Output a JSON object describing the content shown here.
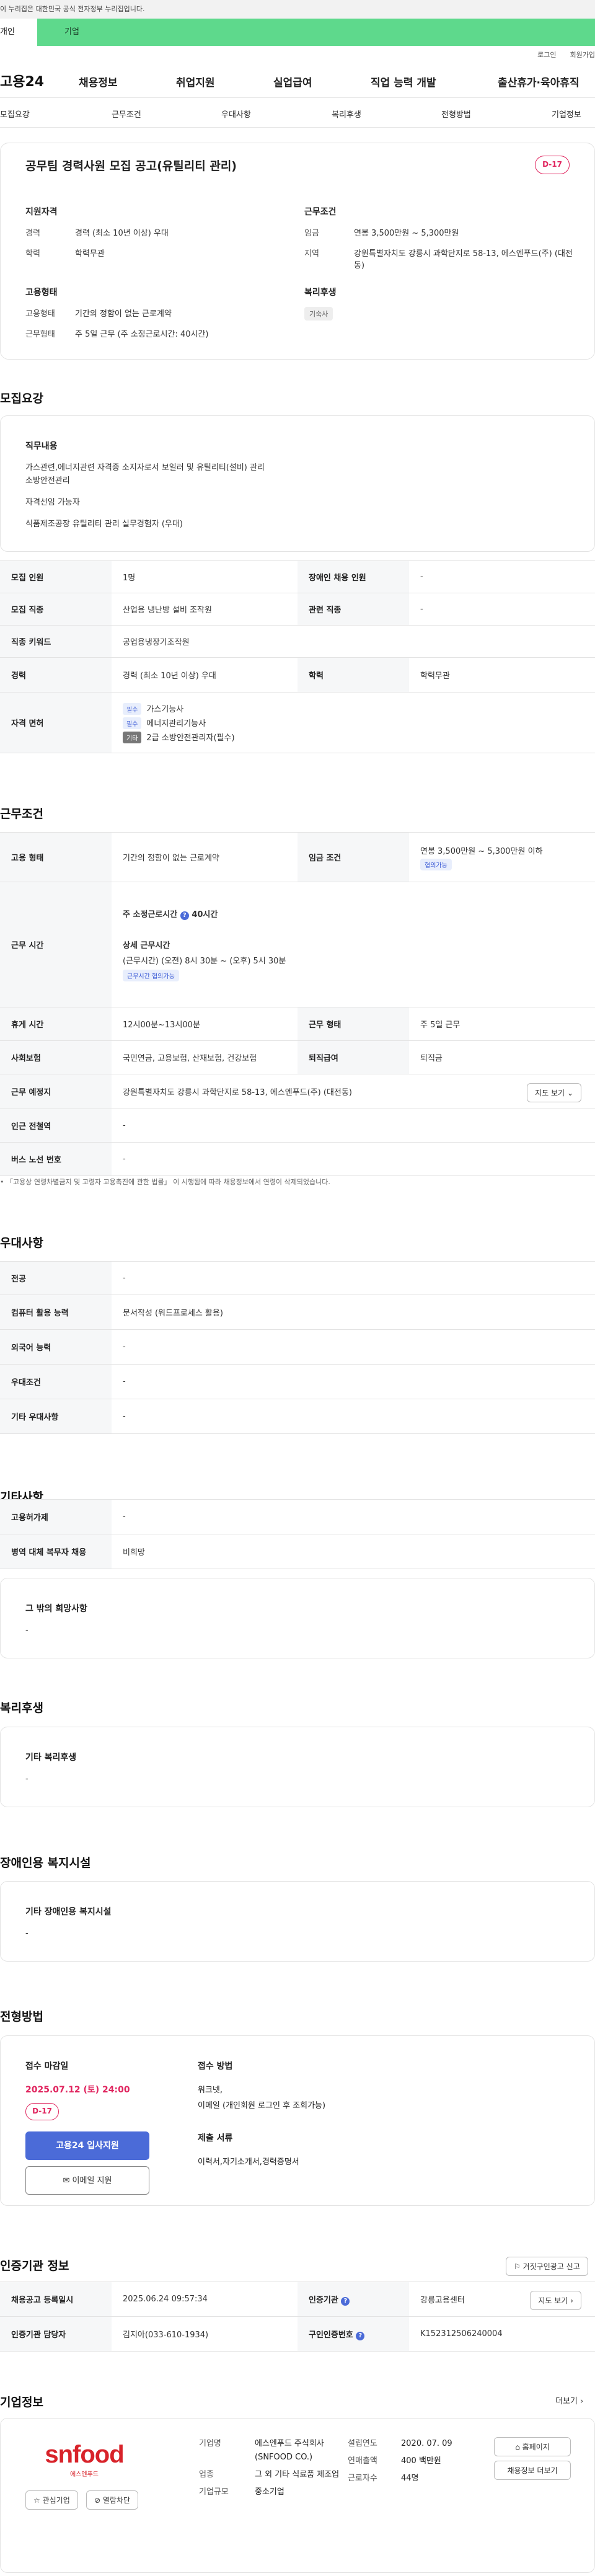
{
  "gov_banner": "이 누리집은 대한민국 공식 전자정부 누리집입니다.",
  "top_tabs": {
    "personal": "개인",
    "company": "기업"
  },
  "util": {
    "login": "로그인",
    "join": "회원가입"
  },
  "logo": "고용24",
  "gnb": [
    "채용정보",
    "취업지원",
    "실업급여",
    "직업 능력 개발",
    "출산휴가·육아휴직"
  ],
  "subnav": [
    "모집요강",
    "근무조건",
    "우대사항",
    "복리후생",
    "전형방법",
    "기업정보"
  ],
  "hero": {
    "title": "공무팀 경력사원 모집 공고(유틸리티 관리)",
    "dday": "D-17",
    "qual_title": "지원자격",
    "qual": [
      {
        "k": "경력",
        "v": "경력 (최소 10년 이상) 우대"
      },
      {
        "k": "학력",
        "v": "학력무관"
      }
    ],
    "cond_title": "근무조건",
    "cond": [
      {
        "k": "임금",
        "v": "연봉 3,500만원 ~ 5,300만원"
      },
      {
        "k": "지역",
        "v": "강원특별자치도 강릉시 과학단지로 58-13, 에스엔푸드(주) (대전동)"
      }
    ],
    "emp_title": "고용형태",
    "emp": [
      {
        "k": "고용형태",
        "v": "기간의 정함이 없는 근로계약"
      },
      {
        "k": "근무형태",
        "v": "주 5일 근무 (주 소정근로시간: 40시간)"
      }
    ],
    "welfare_title": "복리후생",
    "welfare_tag": "기숙사"
  },
  "recruit": {
    "heading": "모집요강",
    "duty_title": "직무내용",
    "duty_lines": [
      "가스관련,에너지관련 자격증 소지자로서 보일러 및 유틸리티(설비) 관리",
      "소방안전관리",
      "자격선임 가능자",
      "식품제조공장 유틸리티 관리 실무경험자 (우대)"
    ],
    "rows": {
      "count_k": "모집 인원",
      "count_v": "1명",
      "disabled_k": "장애인 채용 인원",
      "disabled_v": "-",
      "job_k": "모집 직종",
      "job_v": "산업용 냉난방 설비 조작원",
      "related_k": "관련 직종",
      "related_v": "-",
      "kw_k": "직종 키워드",
      "kw_v": "공업용냉장기조작원",
      "career_k": "경력",
      "career_v": "경력 (최소 10년 이상) 우대",
      "edu_k": "학력",
      "edu_v": "학력무관",
      "lic_k": "자격 면허",
      "licenses": [
        {
          "tag": "필수",
          "name": "가스기능사"
        },
        {
          "tag": "필수",
          "name": "에너지관리기능사"
        },
        {
          "tag": "기타",
          "name": "2급 소방안전관리자(필수)"
        }
      ]
    }
  },
  "work": {
    "heading": "근무조건",
    "emp_k": "고용 형태",
    "emp_v": "기간의 정함이 없는 근로계약",
    "pay_k": "임금 조건",
    "pay_v": "연봉 3,500만원 ~ 5,300만원 이하",
    "pay_tag": "협의가능",
    "hours_k": "근무 시간",
    "hours_total": "주 소정근로시간",
    "hours_total_v": "40시간",
    "hours_detail_title": "상세 근무시간",
    "hours_detail": "(근무시간) (오전) 8시 30분 ~ (오후) 5시 30분",
    "hours_tag": "근무시간 협의가능",
    "break_k": "휴게 시간",
    "break_v": "12시00분~13시00분",
    "type_k": "근무 형태",
    "type_v": "주 5일 근무",
    "ins_k": "사회보험",
    "ins_v": "국민연금, 고용보험, 산재보험, 건강보험",
    "retire_k": "퇴직급여",
    "retire_v": "퇴직금",
    "place_k": "근무 예정지",
    "place_v": "강원특별자치도 강릉시 과학단지로 58-13, 에스엔푸드(주) (대전동)",
    "map_btn": "지도 보기",
    "subway_k": "인근 전철역",
    "subway_v": "-",
    "bus_k": "버스 노선 번호",
    "bus_v": "-",
    "note": "「고용상 연령차별금지 및 고령자 고용촉진에 관한 법률」 이 시행됨에 따라 채용정보에서 연령이 삭제되었습니다."
  },
  "pref": {
    "heading": "우대사항",
    "rows": [
      {
        "k": "전공",
        "v": "-"
      },
      {
        "k": "컴퓨터 활용 능력",
        "v": "문서작성 (워드프로세스 활용)"
      },
      {
        "k": "외국어 능력",
        "v": "-"
      },
      {
        "k": "우대조건",
        "v": "-"
      },
      {
        "k": "기타 우대사항",
        "v": "-"
      }
    ]
  },
  "etc": {
    "heading": "기타사항",
    "rows": [
      {
        "k": "고용허가제",
        "v": "-"
      },
      {
        "k": "병역 대체 복무자 채용",
        "v": "비희망"
      }
    ],
    "other_title": "그 밖의 희망사항",
    "other_v": "-"
  },
  "welfare": {
    "heading": "복리후생",
    "title": "기타 복리후생",
    "v": "-"
  },
  "disabled": {
    "heading": "장애인용 복지시설",
    "title": "기타 장애인용 복지시설",
    "v": "-"
  },
  "process": {
    "heading": "전형방법",
    "deadline_title": "접수 마감일",
    "deadline": "2025.07.12 (토) 24:00",
    "dday": "D-17",
    "apply_btn": "고용24 입사지원",
    "email_btn": "이메일 지원",
    "method_title": "접수 방법",
    "method_lines": [
      "워크넷,",
      "이메일 (개인회원 로그인 후 조회가능)"
    ],
    "docs_title": "제출 서류",
    "docs": "이력서,자기소개서,경력증명서"
  },
  "cert": {
    "heading": "인증기관 정보",
    "report_btn": "거짓구인광고 신고",
    "reg_k": "채용공고 등록일시",
    "reg_v": "2025.06.24 09:57:34",
    "org_k": "인증기관",
    "org_v": "강릉고용센터",
    "map_btn": "지도 보기",
    "mgr_k": "인증기관 담당자",
    "mgr_v": "김지아(033-610-1934)",
    "id_k": "구인인증번호",
    "id_v": "K152312506240004"
  },
  "company": {
    "heading": "기업정보",
    "more": "더보기",
    "logo": "snfood",
    "logo_sub": "에스엔푸드",
    "interest_btn": "관심기업",
    "block_btn": "열람차단",
    "name_k": "기업명",
    "name_v": "에스엔푸드 주식회사 (SNFOOD CO.)",
    "ind_k": "업종",
    "ind_v": "그 외 기타 식료품 제조업",
    "size_k": "기업규모",
    "size_v": "중소기업",
    "founded_k": "설립연도",
    "founded_v": "2020. 07. 09",
    "sales_k": "연매출액",
    "sales_v": "400 백만원",
    "staff_k": "근로자수",
    "staff_v": "44명",
    "home_btn": "홈페이지",
    "more_jobs_btn": "채용정보 더보기"
  }
}
